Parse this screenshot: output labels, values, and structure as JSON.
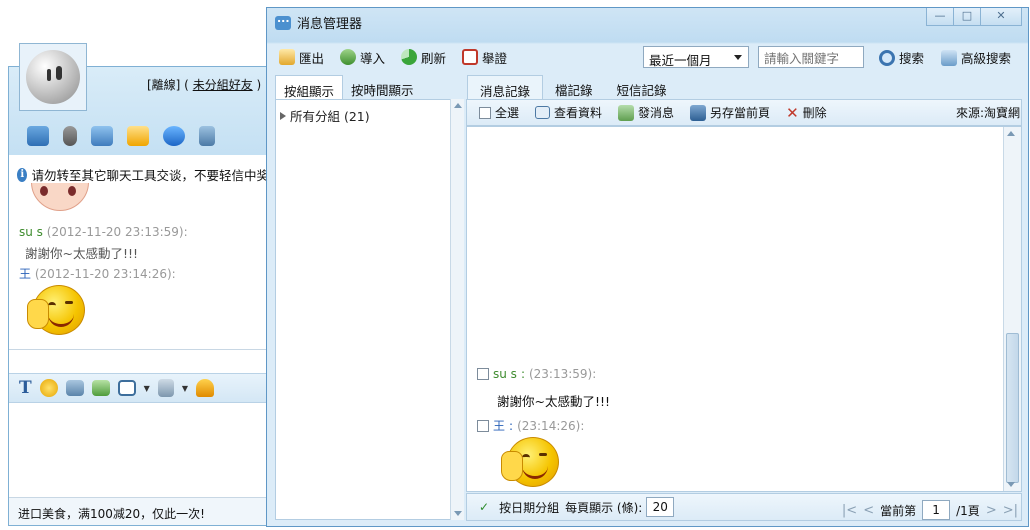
{
  "chat": {
    "status_text": "[離線] ( ",
    "group_link": "未分組好友",
    "status_close": " )",
    "notice": "请勿转至其它聊天工具交谈，不要轻信中奖",
    "messages": [
      {
        "sender": "su        s",
        "time": "(2012-11-20 23:13:59):",
        "text": "謝謝你~太感動了!!!"
      },
      {
        "sender": "王",
        "time": "(2012-11-20 23:14:26):",
        "text": ""
      }
    ],
    "bottom_ad": "进口美食，满100减20，仅此一次!"
  },
  "manager": {
    "title": "消息管理器",
    "toolbar": {
      "export": "匯出",
      "import": "導入",
      "refresh": "刷新",
      "report": "舉證",
      "range": "最近一個月",
      "search_placeholder": "請輸入關鍵字",
      "search": "搜索",
      "advanced_search": "高級搜索"
    },
    "left_tabs": [
      "按組顯示",
      "按時間顯示"
    ],
    "tree_root": "所有分組 (21)",
    "right_tabs": [
      "消息記錄",
      "檔記錄",
      "短信記錄"
    ],
    "subbar": {
      "select_all": "全選",
      "view_profile": "查看資料",
      "send_message": "發消息",
      "save_page": "另存當前頁",
      "delete": "刪除",
      "source": "來源:淘寶網"
    },
    "records": [
      {
        "sender": "su        s",
        "time": "(23:13:59):",
        "text": "謝謝你~太感動了!!!"
      },
      {
        "sender": "王",
        "time": "(23:14:26):",
        "text": ""
      }
    ],
    "footer": {
      "group_by_date": "按日期分組",
      "per_page_label": "每頁顯示 (條):",
      "per_page": "20",
      "current_label": "當前第",
      "page": "1",
      "total": "/1頁"
    }
  },
  "colors": {
    "accent": "#4b90cf",
    "sender_green": "#3d8b2d",
    "sender_blue": "#2a62b8"
  }
}
